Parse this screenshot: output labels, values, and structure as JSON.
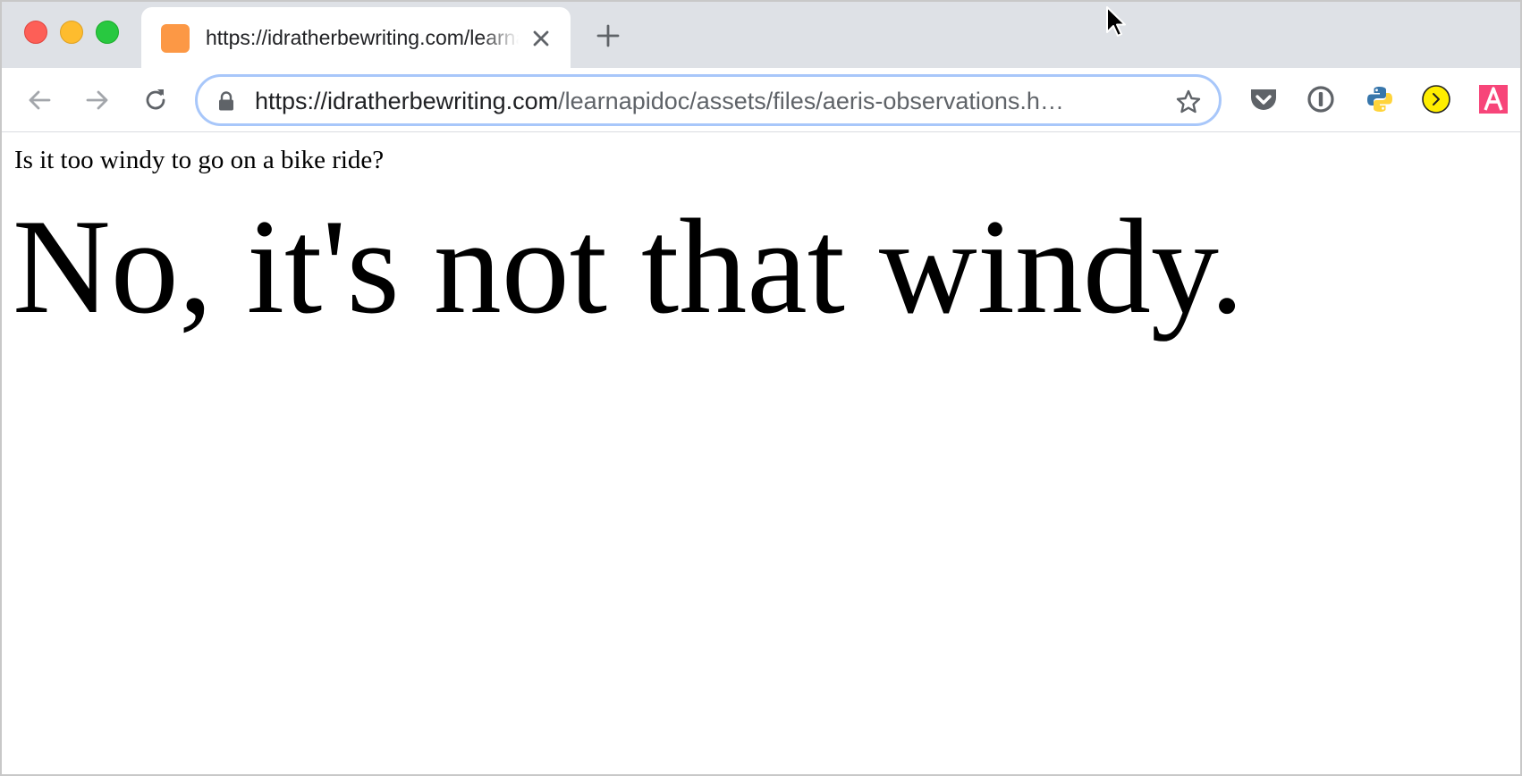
{
  "browser": {
    "tab": {
      "title": "https://idratherbewriting.com/learnapidoc/assets/files/aeris-observations.html",
      "favicon": "orange-square-favicon",
      "favicon_color": "#fc9845"
    },
    "new_tab_icon": "plus-icon",
    "address_bar": {
      "url_host": "https://idratherbewriting.com",
      "url_path": "/learnapidoc/assets/files/aeris-observations.h…",
      "focus_color": "#a8c7fa"
    },
    "extensions": [
      "pocket-icon",
      "1password-icon",
      "python-icon",
      "yellow-play-icon",
      "adobe-a-icon"
    ]
  },
  "page": {
    "question": "Is it too windy to go on a bike ride?",
    "answer": "No, it's not that windy."
  }
}
